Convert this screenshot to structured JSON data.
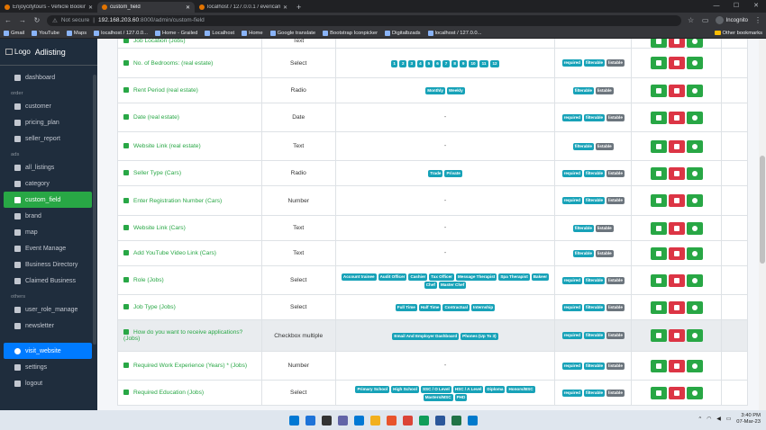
{
  "browser": {
    "tabs": [
      {
        "title": "Enjoycitytours - Vehicle Booking"
      },
      {
        "title": "custom_field",
        "active": true
      },
      {
        "title": "localhost / 127.0.0.1 / evericam"
      }
    ],
    "new_tab": "+",
    "url_prefix": "Not secure",
    "url_host": "192.168.203.60",
    "url_path": ":8000/admin/custom-field",
    "profile": "Incognito",
    "bookmarks": [
      "Gmail",
      "YouTube",
      "Maps",
      "localhost / 127.0.0...",
      "Home - Grailed",
      "Localhost",
      "Home",
      "Google translate",
      "Bootstrap Iconpicker",
      "Digitalbzads",
      "localhost / 127.0.0..."
    ],
    "other_bookmarks": "Other bookmarks"
  },
  "sidebar": {
    "logo_text": "Logo",
    "app_name": "Adlisting",
    "items_top": [
      {
        "label": "dashboard",
        "icon": "tachometer-icon"
      }
    ],
    "section_order": "order",
    "items_order": [
      {
        "label": "customer",
        "icon": "users-icon"
      },
      {
        "label": "pricing_plan",
        "icon": "list-icon"
      },
      {
        "label": "seller_report",
        "icon": "file-icon"
      }
    ],
    "section_ads": "ads",
    "items_ads": [
      {
        "label": "all_listings",
        "icon": "list-icon"
      },
      {
        "label": "category",
        "icon": "grid-icon"
      },
      {
        "label": "custom_field",
        "icon": "edit-icon",
        "active": true
      },
      {
        "label": "brand",
        "icon": "tag-icon"
      },
      {
        "label": "map",
        "icon": "map-marker-icon"
      },
      {
        "label": "Event Manage",
        "icon": "calendar-icon"
      },
      {
        "label": "Business Directory",
        "icon": "users-icon"
      },
      {
        "label": "Claimed Business",
        "icon": "users-icon"
      }
    ],
    "section_others": "others",
    "items_others": [
      {
        "label": "user_role_manage",
        "icon": "user-icon"
      },
      {
        "label": "newsletter",
        "icon": "envelope-icon"
      }
    ],
    "visit": {
      "label": "visit_website",
      "icon": "globe-icon"
    },
    "items_bottom": [
      {
        "label": "settings",
        "icon": "gear-icon"
      },
      {
        "label": "logout",
        "icon": "sign-out-icon"
      }
    ]
  },
  "table": {
    "rows": [
      {
        "name": "Job Location (Jobs)",
        "type": "Text",
        "options": [],
        "dash": "",
        "flags": []
      },
      {
        "name": "No. of Bedrooms: (real estate)",
        "type": "Select",
        "options": [
          "1",
          "2",
          "3",
          "4",
          "5",
          "6",
          "7",
          "8",
          "9",
          "10",
          "11",
          "12"
        ],
        "numeric": true,
        "flags": [
          "required",
          "filterable",
          "listable"
        ]
      },
      {
        "name": "Rent Period (real estate)",
        "type": "Radio",
        "options": [
          "Monthly",
          "Weekly"
        ],
        "flags": [
          "filterable",
          "listable"
        ]
      },
      {
        "name": "Date (real estate)",
        "type": "Date",
        "options": [],
        "dash": "-",
        "flags": [
          "required",
          "filterable",
          "listable"
        ]
      },
      {
        "name": "Website Link (real estate)",
        "type": "Text",
        "options": [],
        "dash": "-",
        "flags": [
          "filterable",
          "listable"
        ]
      },
      {
        "name": "Seller Type (Cars)",
        "type": "Radio",
        "options": [
          "Trade",
          "Private"
        ],
        "flags": [
          "required",
          "filterable",
          "listable"
        ]
      },
      {
        "name": "Enter Registration Number (Cars)",
        "type": "Number",
        "options": [],
        "dash": "-",
        "flags": [
          "required",
          "filterable",
          "listable"
        ]
      },
      {
        "name": "Website Link (Cars)",
        "type": "Text",
        "options": [],
        "dash": "-",
        "flags": [
          "filterable",
          "listable"
        ]
      },
      {
        "name": "Add YouTube Video Link (Cars)",
        "type": "Text",
        "options": [],
        "dash": "-",
        "flags": [
          "filterable",
          "listable"
        ]
      },
      {
        "name": "Role (Jobs)",
        "type": "Select",
        "options": [
          "Account trainee",
          "Audit Officer",
          "Cashier",
          "Tax Officer",
          "Message Therapist",
          "Spa Therapist",
          "Bakeer",
          "Chef",
          "Master Chef"
        ],
        "flags": [
          "required",
          "filterable",
          "listable"
        ]
      },
      {
        "name": "Job Type (Jobs)",
        "type": "Select",
        "options": [
          "Full Time",
          "Half Time",
          "Contractual",
          "Internship"
        ],
        "flags": [
          "required",
          "filterable",
          "listable"
        ]
      },
      {
        "name": "How do you want to receive applications? (Jobs)",
        "type": "Checkbox multiple",
        "options": [
          "Email And Employer Dashboard",
          "Phones (Up To 3)"
        ],
        "flags": [
          "required",
          "filterable",
          "listable"
        ],
        "highlight": true
      },
      {
        "name": "Required Work Experience (Years) * (Jobs)",
        "type": "Number",
        "options": [],
        "dash": "-",
        "flags": [
          "required",
          "filterable",
          "listable"
        ]
      },
      {
        "name": "Required Education (Jobs)",
        "type": "Select",
        "options": [
          "Primary School",
          "High School",
          "SSC / O Level",
          "HSC / A Level",
          "Diploma",
          "Honors/BSC",
          "Masters/MSC",
          "PHD"
        ],
        "flags": [
          "required",
          "filterable",
          "listable"
        ]
      }
    ]
  },
  "taskbar": {
    "time": "3:40 PM",
    "date": "07-Mar-23",
    "apps": [
      {
        "color": "#1e73d8"
      },
      {
        "color": "#333333"
      },
      {
        "color": "#6264a7"
      },
      {
        "color": "#0078d4"
      },
      {
        "color": "#f2b01e"
      },
      {
        "color": "#e8542c"
      },
      {
        "color": "#db4437"
      },
      {
        "color": "#0f9d58"
      },
      {
        "color": "#2b579a"
      },
      {
        "color": "#217346"
      },
      {
        "color": "#007acc"
      }
    ]
  }
}
